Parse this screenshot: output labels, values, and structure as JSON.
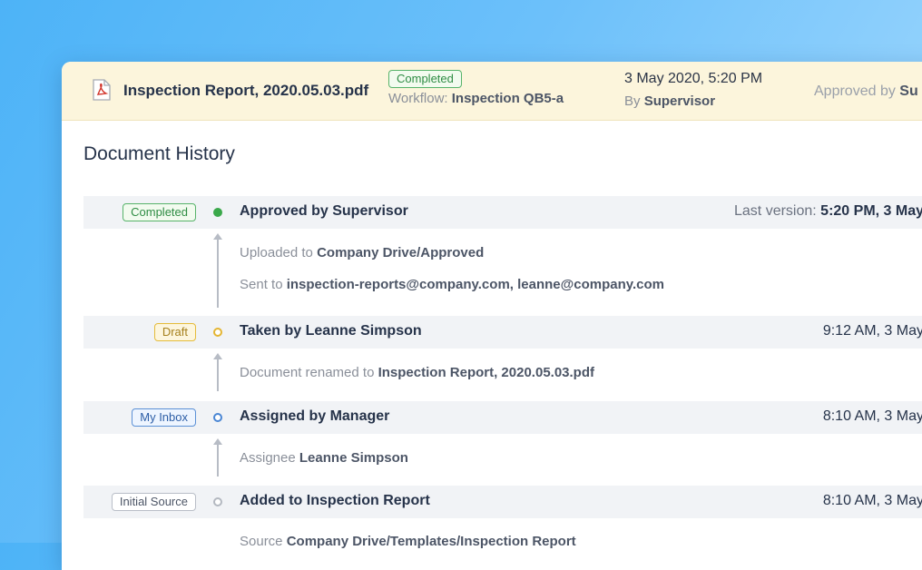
{
  "header": {
    "doc_title": "Inspection Report, 2020.05.03.pdf",
    "status": "Completed",
    "workflow_label": "Workflow:",
    "workflow_value": "Inspection QB5-a",
    "date": "3 May 2020, 5:20 PM",
    "by_label": "By",
    "by_value": "Supervisor",
    "approved_label": "Approved by",
    "approved_value": "Su"
  },
  "history": {
    "title": "Document History",
    "events": [
      {
        "tag": "Completed",
        "event": "Approved by Supervisor",
        "time_prefix": "Last version:",
        "time": "5:20 PM, 3 May",
        "details": [
          {
            "label": "Uploaded to",
            "value": "Company Drive/Approved"
          },
          {
            "label": "Sent to",
            "value": "inspection-reports@company.com, leanne@company.com"
          }
        ]
      },
      {
        "tag": "Draft",
        "event": "Taken by Leanne Simpson",
        "time": "9:12 AM, 3 May",
        "details": [
          {
            "label": "Document renamed to",
            "value": "Inspection Report, 2020.05.03.pdf"
          }
        ]
      },
      {
        "tag": "My Inbox",
        "event": "Assigned by Manager",
        "time": "8:10 AM, 3 May",
        "details": [
          {
            "label": "Assignee",
            "value": "Leanne Simpson"
          }
        ]
      },
      {
        "tag": "Initial Source",
        "event": "Added to Inspection Report",
        "time": "8:10 AM, 3 May",
        "details": [
          {
            "label": "Source",
            "value": "Company Drive/Templates/Inspection Report"
          }
        ]
      }
    ]
  },
  "colors": {
    "completed": "#3aa84a",
    "draft": "#e4b532",
    "inbox": "#4a86d4",
    "source": "#b3b8c0"
  },
  "icons": {
    "file": "pdf-file-icon"
  }
}
